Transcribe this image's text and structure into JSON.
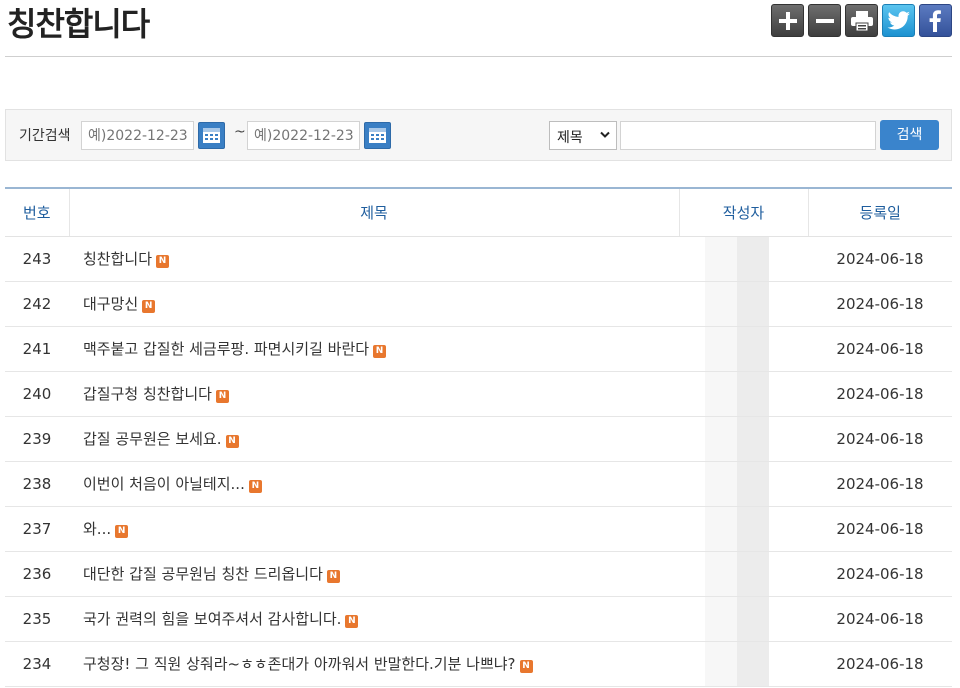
{
  "page": {
    "title": "칭찬합니다"
  },
  "toolbar": {
    "buttons": [
      {
        "icon": "plus-icon"
      },
      {
        "icon": "minus-icon"
      },
      {
        "icon": "print-icon"
      },
      {
        "icon": "twitter-icon"
      },
      {
        "icon": "facebook-icon"
      }
    ]
  },
  "search": {
    "period_label": "기간검색",
    "date_from_placeholder": "예)2022-12-23",
    "date_to_placeholder": "예)2022-12-23",
    "range_sep": "~",
    "field_selected": "제목",
    "keyword_value": "",
    "button_label": "검색"
  },
  "table": {
    "headers": {
      "num": "번호",
      "subject": "제목",
      "author": "작성자",
      "date": "등록일"
    },
    "new_badge": "N",
    "rows": [
      {
        "num": "243",
        "subject": "칭찬합니다",
        "date": "2024-06-18"
      },
      {
        "num": "242",
        "subject": "대구망신",
        "date": "2024-06-18"
      },
      {
        "num": "241",
        "subject": "맥주붙고 갑질한 세금루팡. 파면시키길 바란다",
        "date": "2024-06-18"
      },
      {
        "num": "240",
        "subject": "갑질구청 칭찬합니다",
        "date": "2024-06-18"
      },
      {
        "num": "239",
        "subject": "갑질 공무원은 보세요.",
        "date": "2024-06-18"
      },
      {
        "num": "238",
        "subject": "이번이 처음이 아닐테지...",
        "date": "2024-06-18"
      },
      {
        "num": "237",
        "subject": "와...",
        "date": "2024-06-18"
      },
      {
        "num": "236",
        "subject": "대단한 갑질 공무원님 칭찬 드리옵니다",
        "date": "2024-06-18"
      },
      {
        "num": "235",
        "subject": "국가 권력의 힘을 보여주셔서 감사합니다.",
        "date": "2024-06-18"
      },
      {
        "num": "234",
        "subject": "구청장! 그 직원 상줘라~ㅎㅎ존대가 아까워서 반말한다.기분 나쁘냐?",
        "date": "2024-06-18"
      }
    ]
  },
  "colors": {
    "accent": "#3a84cc",
    "header_text": "#1f5e9e",
    "new_badge": "#e8772e"
  }
}
